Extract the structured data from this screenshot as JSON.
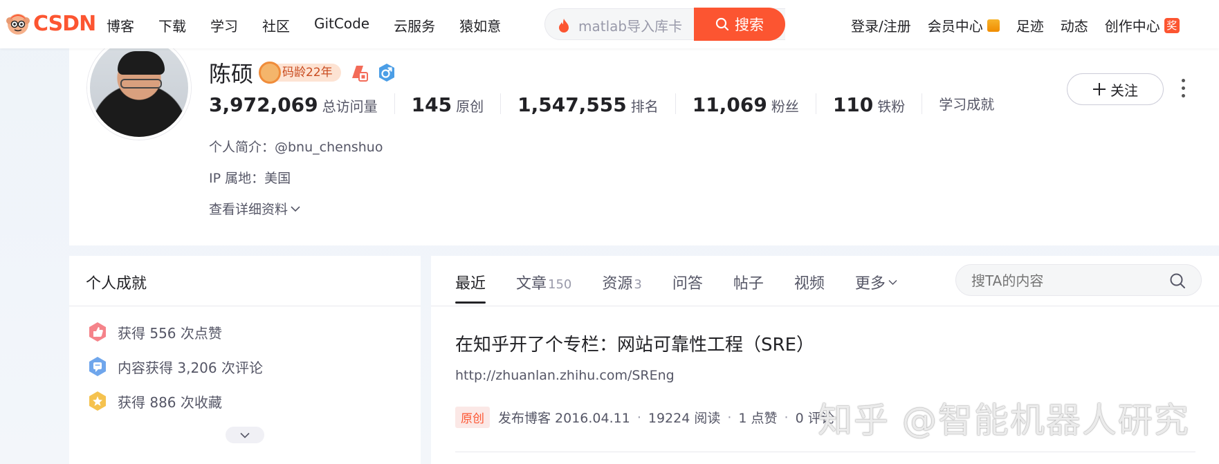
{
  "nav": {
    "logo": "CSDN",
    "items": [
      "博客",
      "下载",
      "学习",
      "社区",
      "GitCode",
      "云服务",
      "猿如意"
    ],
    "search_value": "matlab导入库卡",
    "search_button": "搜索",
    "right_items": {
      "login": "登录/注册",
      "vip": "会员中心",
      "footprint": "足迹",
      "dynamic": "动态",
      "creator": "创作中心",
      "creator_badge": "奖"
    }
  },
  "profile": {
    "name": "陈硕",
    "code_age": "码龄22年",
    "stats": [
      {
        "num": "3,972,069",
        "label": "总访问量"
      },
      {
        "num": "145",
        "label": "原创"
      },
      {
        "num": "1,547,555",
        "label": "排名"
      },
      {
        "num": "11,069",
        "label": "粉丝"
      },
      {
        "num": "110",
        "label": "铁粉"
      }
    ],
    "achievement_link": "学习成就",
    "bio": "个人简介：@bnu_chenshuo",
    "ip": "IP 属地：美国",
    "details": "查看详细资料",
    "follow": "关注"
  },
  "achievements": {
    "title": "个人成就",
    "items": [
      "获得 556 次点赞",
      "内容获得 3,206 次评论",
      "获得 886 次收藏"
    ]
  },
  "main": {
    "tabs": [
      {
        "label": "最近",
        "count": ""
      },
      {
        "label": "文章",
        "count": "150"
      },
      {
        "label": "资源",
        "count": "3"
      },
      {
        "label": "问答",
        "count": ""
      },
      {
        "label": "帖子",
        "count": ""
      },
      {
        "label": "视频",
        "count": ""
      }
    ],
    "more": "更多",
    "search_placeholder": "搜TA的内容",
    "post": {
      "title": "在知乎开了个专栏：网站可靠性工程（SRE）",
      "desc": "http://zhuanlan.zhihu.com/SREng",
      "tag": "原创",
      "published": "发布博客 2016.04.11",
      "reads": "19224 阅读",
      "likes": "1 点赞",
      "comments": "0 评论"
    }
  },
  "watermark": "知乎 @智能机器人研究",
  "colors": {
    "accent": "#fc5531",
    "text": "#222226",
    "muted": "#555666"
  }
}
